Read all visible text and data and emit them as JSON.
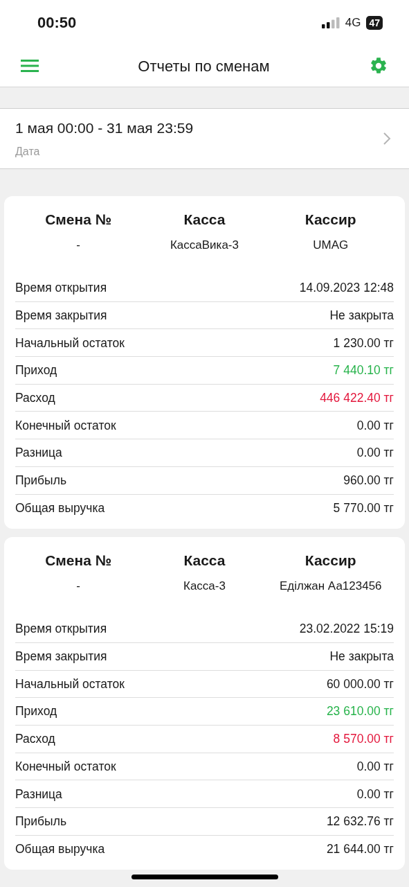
{
  "status_bar": {
    "time": "00:50",
    "network": "4G",
    "battery": "47"
  },
  "app_bar": {
    "title": "Отчеты по сменам"
  },
  "date_filter": {
    "value": "1 мая 00:00 - 31 мая 23:59",
    "label": "Дата"
  },
  "shifts": [
    {
      "headers": [
        "Смена №",
        "Касса",
        "Кассир"
      ],
      "values": [
        "-",
        "КассаВика-3",
        "UMAG"
      ],
      "rows": [
        {
          "label": "Время открытия",
          "value": "14.09.2023 12:48",
          "kind": "plain"
        },
        {
          "label": "Время закрытия",
          "value": "Не закрыта",
          "kind": "plain"
        },
        {
          "label": "Начальный остаток",
          "value": "1 230.00 тг",
          "kind": "plain"
        },
        {
          "label": "Приход",
          "value": "7 440.10 тг",
          "kind": "income"
        },
        {
          "label": "Расход",
          "value": "446 422.40 тг",
          "kind": "expense"
        },
        {
          "label": "Конечный остаток",
          "value": "0.00 тг",
          "kind": "plain"
        },
        {
          "label": "Разница",
          "value": "0.00 тг",
          "kind": "plain"
        },
        {
          "label": "Прибыль",
          "value": "960.00 тг",
          "kind": "plain"
        },
        {
          "label": "Общая выручка",
          "value": "5 770.00 тг",
          "kind": "plain"
        }
      ]
    },
    {
      "headers": [
        "Смена №",
        "Касса",
        "Кассир"
      ],
      "values": [
        "-",
        "Касса-3",
        "Еділжан Аа123456"
      ],
      "rows": [
        {
          "label": "Время открытия",
          "value": "23.02.2022 15:19",
          "kind": "plain"
        },
        {
          "label": "Время закрытия",
          "value": "Не закрыта",
          "kind": "plain"
        },
        {
          "label": "Начальный остаток",
          "value": "60 000.00 тг",
          "kind": "plain"
        },
        {
          "label": "Приход",
          "value": "23 610.00 тг",
          "kind": "income"
        },
        {
          "label": "Расход",
          "value": "8 570.00 тг",
          "kind": "expense"
        },
        {
          "label": "Конечный остаток",
          "value": "0.00 тг",
          "kind": "plain"
        },
        {
          "label": "Разница",
          "value": "0.00 тг",
          "kind": "plain"
        },
        {
          "label": "Прибыль",
          "value": "12 632.76 тг",
          "kind": "plain"
        },
        {
          "label": "Общая выручка",
          "value": "21 644.00 тг",
          "kind": "plain"
        }
      ]
    }
  ]
}
